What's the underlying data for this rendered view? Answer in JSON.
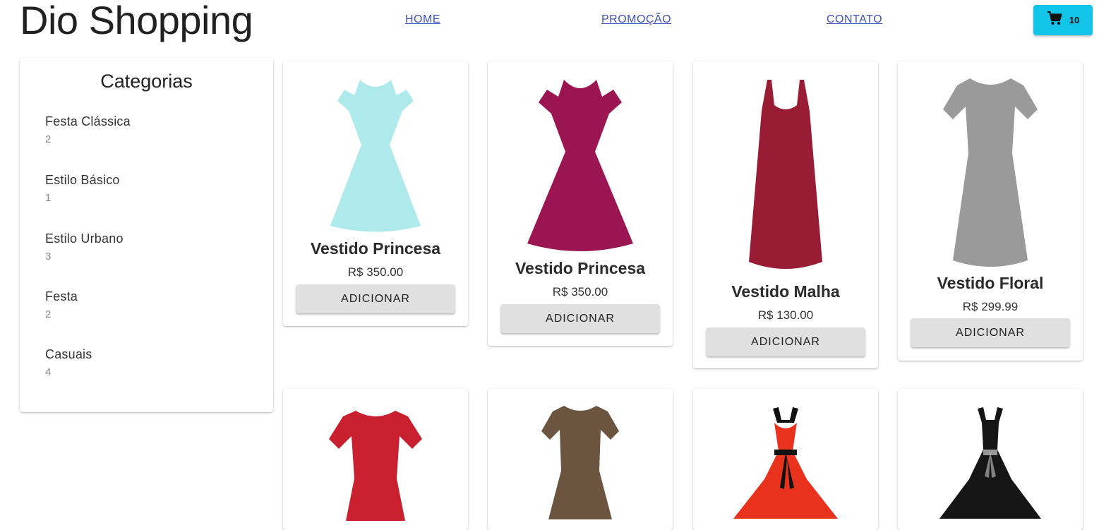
{
  "header": {
    "brand": "Dio Shopping",
    "nav": [
      "HOME",
      "PROMOÇÃO",
      "CONTATO"
    ],
    "cart_count": "10",
    "cart_icon": "shopping-cart-icon",
    "cart_color": "#12c4e8"
  },
  "sidebar": {
    "title": "Categorias",
    "categories": [
      {
        "name": "Festa Clássica",
        "count": "2"
      },
      {
        "name": "Estilo Básico",
        "count": "1"
      },
      {
        "name": "Estilo Urbano",
        "count": "3"
      },
      {
        "name": "Festa",
        "count": "2"
      },
      {
        "name": "Casuais",
        "count": "4"
      }
    ]
  },
  "products": [
    {
      "name": "Vestido Princesa",
      "price": "R$ 350.00",
      "button": "ADICIONAR",
      "color": "#aeeaeb"
    },
    {
      "name": "Vestido Princesa",
      "price": "R$ 350.00",
      "button": "ADICIONAR",
      "color": "#9c1553"
    },
    {
      "name": "Vestido Malha",
      "price": "R$ 130.00",
      "button": "ADICIONAR",
      "color": "#981c33"
    },
    {
      "name": "Vestido Floral",
      "price": "R$ 299.99",
      "button": "ADICIONAR",
      "color": "#9a9a9a"
    },
    {
      "color": "#c8202e"
    },
    {
      "color": "#6b5440"
    },
    {
      "color": "#e8321e"
    },
    {
      "color": "#151515"
    }
  ]
}
